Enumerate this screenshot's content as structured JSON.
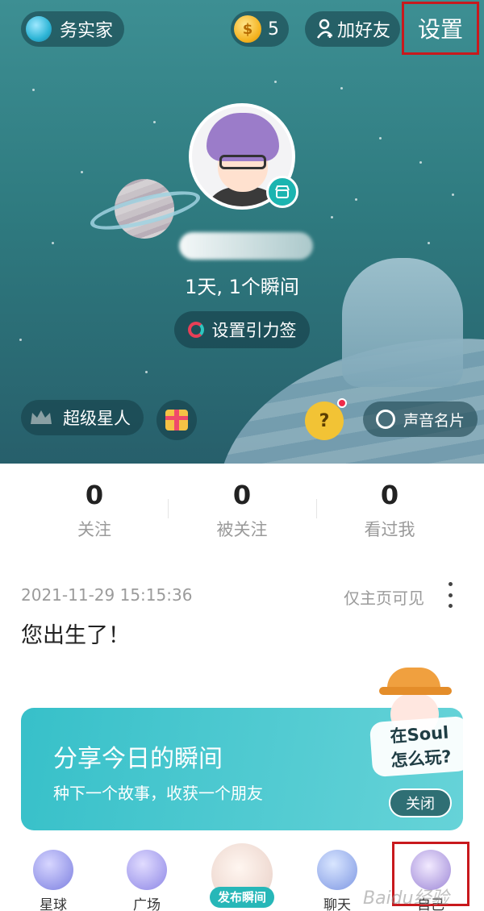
{
  "header": {
    "planet_pill_label": "务实家",
    "coins": "5",
    "add_friend_label": "加好友",
    "settings_label": "设置"
  },
  "profile": {
    "stats_line": "1天, 1个瞬间",
    "gravity_tag_label": "设置引力签",
    "superstar_label": "超级星人",
    "voice_card_label": "声音名片",
    "question_glyph": "?"
  },
  "counts": [
    {
      "value": "0",
      "label": "关注"
    },
    {
      "value": "0",
      "label": "被关注"
    },
    {
      "value": "0",
      "label": "看过我"
    }
  ],
  "post": {
    "timestamp": "2021-11-29 15:15:36",
    "visibility": "仅主页可见",
    "text": "您出生了！"
  },
  "share_card": {
    "title": "分享今日的瞬间",
    "subtitle": "种下一个故事，收获一个朋友",
    "guide_line1": "在Soul",
    "guide_line2": "怎么玩?",
    "close_label": "关闭"
  },
  "nav": {
    "items": [
      {
        "label": "星球"
      },
      {
        "label": "广场"
      },
      {
        "label": "发布瞬间"
      },
      {
        "label": "聊天"
      },
      {
        "label": "自己"
      }
    ]
  },
  "watermark": "Baidu经验",
  "colors": {
    "accent_red_box": "#c8191d",
    "teal": "#2f7b80",
    "coin_gold": "#f5b320"
  }
}
